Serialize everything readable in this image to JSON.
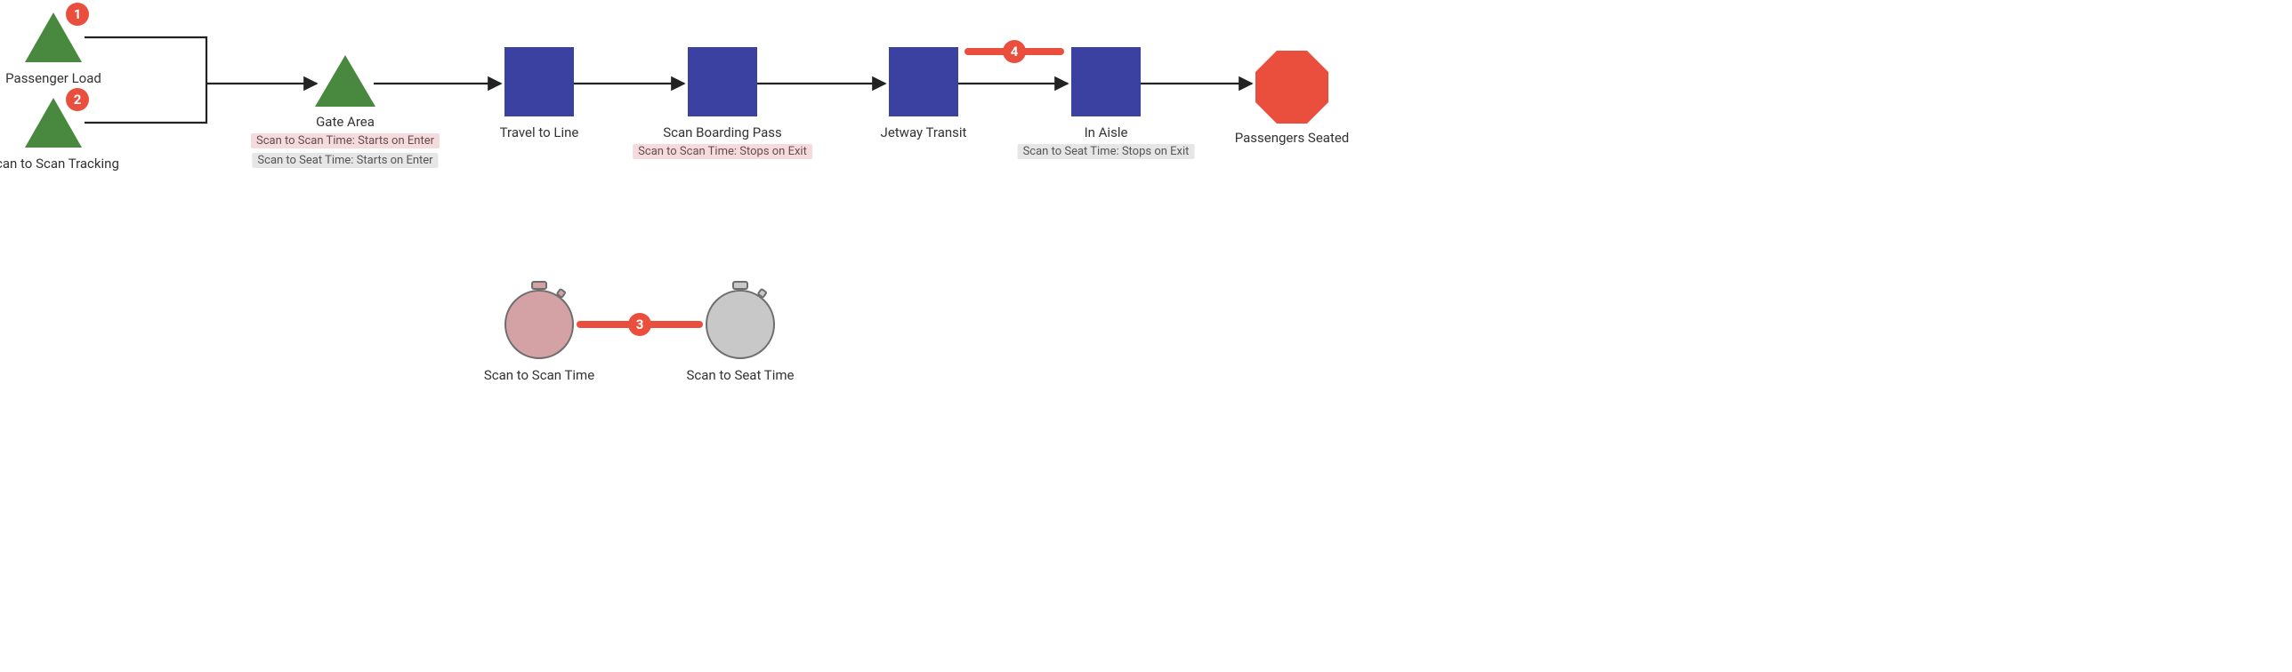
{
  "colors": {
    "green": "#49893f",
    "blue": "#3a41a1",
    "red": "#ea4e3d",
    "pinkFill": "#d4a1a4",
    "greyFill": "#c8c8c8",
    "stroke": "#6e6e6e"
  },
  "nodes": {
    "passenger_load": "Passenger Load",
    "scan_tracking": "Scan to Scan Tracking",
    "gate_area": "Gate Area",
    "gate_area_tag1": "Scan to Scan Time: Starts on Enter",
    "gate_area_tag2": "Scan to Seat Time: Starts on Enter",
    "travel_to_line": "Travel to Line",
    "scan_pass": "Scan Boarding Pass",
    "scan_pass_tag": "Scan to Scan Time: Stops on Exit",
    "jetway": "Jetway Transit",
    "in_aisle": "In Aisle",
    "in_aisle_tag": "Scan to Seat Time: Stops on Exit",
    "seated": "Passengers Seated"
  },
  "timers": {
    "scan_to_scan": "Scan to Scan Time",
    "scan_to_seat": "Scan to Seat Time"
  },
  "badges": {
    "b1": "1",
    "b2": "2",
    "b3": "3",
    "b4": "4"
  }
}
